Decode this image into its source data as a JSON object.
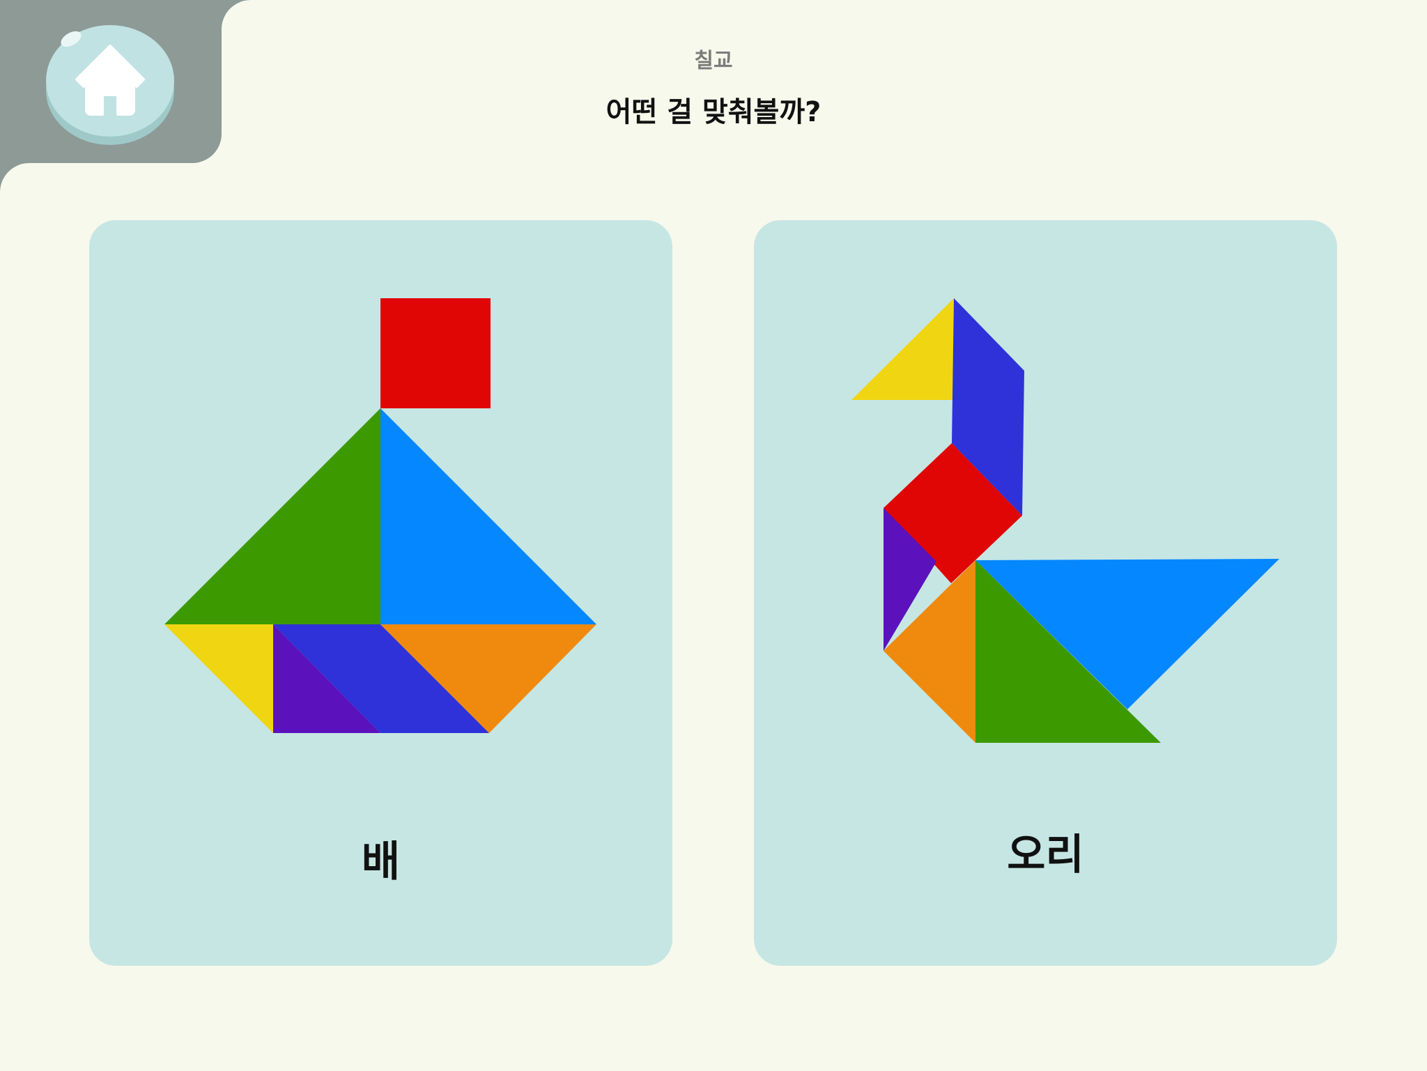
{
  "header": {
    "subtitle": "칠교",
    "title": "어떤 걸 맞춰볼까?"
  },
  "home_button": {
    "icon": "home-icon"
  },
  "cards": [
    {
      "label": "배"
    },
    {
      "label": "오리"
    }
  ],
  "colors": {
    "background": "#f7f9ec",
    "corner_panel": "#8d9a96",
    "card": "#c6e6e4",
    "home_button": "#c0e2e2",
    "red": "#e00606",
    "green": "#3c9a00",
    "light_blue": "#0587ff",
    "yellow": "#f0d612",
    "purple": "#5b12bd",
    "dark_blue": "#2e32d8",
    "orange": "#ef8a0f"
  }
}
